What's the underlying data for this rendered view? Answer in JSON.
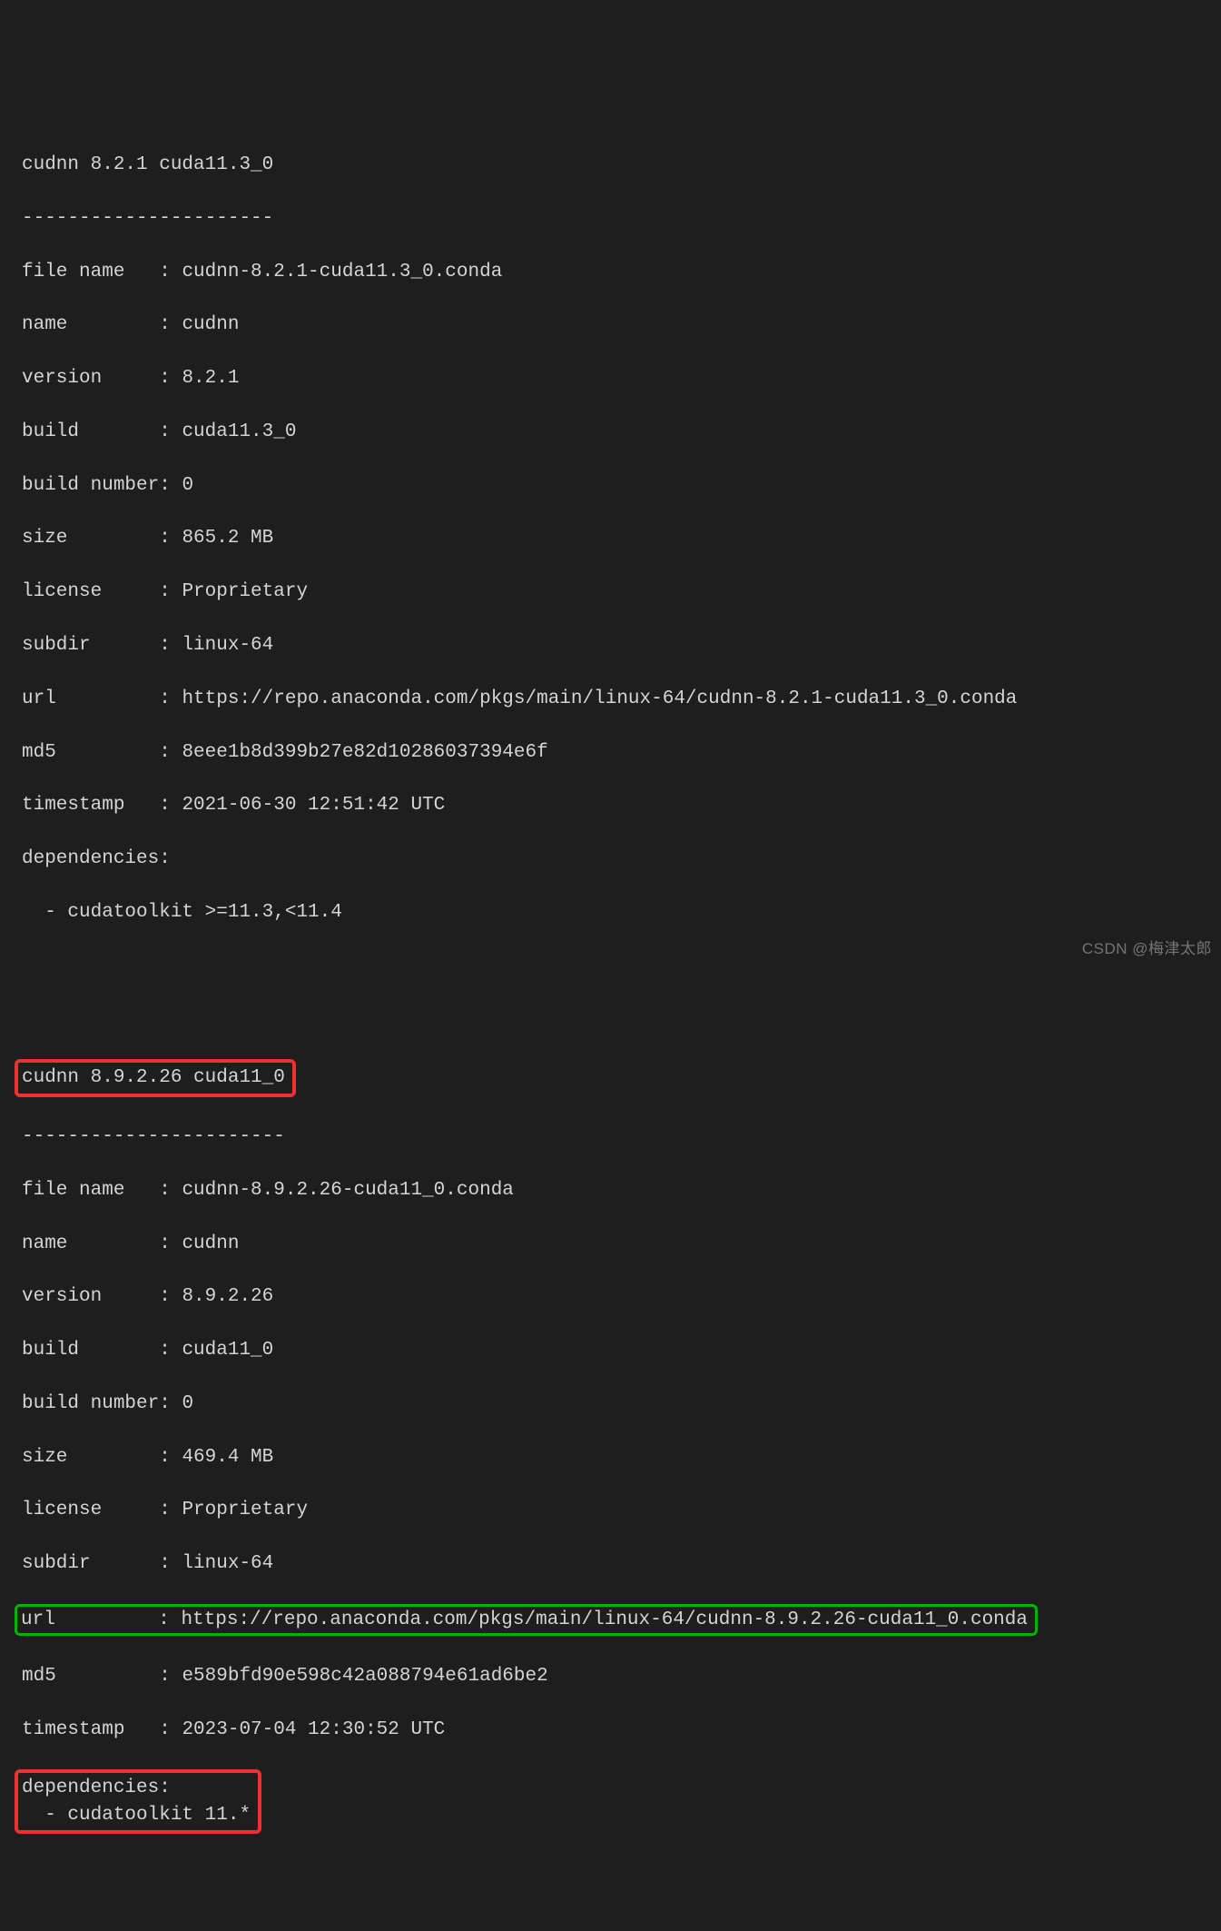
{
  "block1": {
    "header": "cudnn 8.2.1 cuda11.3_0",
    "dashes": "----------------------",
    "file_name_label": "file name   : ",
    "file_name": "cudnn-8.2.1-cuda11.3_0.conda",
    "name_label": "name        : ",
    "name": "cudnn",
    "version_label": "version     : ",
    "version": "8.2.1",
    "build_label": "build       : ",
    "build": "cuda11.3_0",
    "buildnum_label": "build number: ",
    "buildnum": "0",
    "size_label": "size        : ",
    "size": "865.2 MB",
    "license_label": "license     : ",
    "license": "Proprietary",
    "subdir_label": "subdir      : ",
    "subdir": "linux-64",
    "url_label": "url         : ",
    "url": "https://repo.anaconda.com/pkgs/main/linux-64/cudnn-8.2.1-cuda11.3_0.conda",
    "md5_label": "md5         : ",
    "md5": "8eee1b8d399b27e82d10286037394e6f",
    "timestamp_label": "timestamp   : ",
    "timestamp": "2021-06-30 12:51:42 UTC",
    "deps_label": "dependencies: ",
    "deps_item": "  - cudatoolkit >=11.3,<11.4"
  },
  "block2": {
    "header": "cudnn 8.9.2.26 cuda11_0",
    "dashes": "-----------------------",
    "file_name_label": "file name   : ",
    "file_name": "cudnn-8.9.2.26-cuda11_0.conda",
    "name_label": "name        : ",
    "name": "cudnn",
    "version_label": "version     : ",
    "version": "8.9.2.26",
    "build_label": "build       : ",
    "build": "cuda11_0",
    "buildnum_label": "build number: ",
    "buildnum": "0",
    "size_label": "size        : ",
    "size": "469.4 MB",
    "license_label": "license     : ",
    "license": "Proprietary",
    "subdir_label": "subdir      : ",
    "subdir": "linux-64",
    "url_label": "url         : ",
    "url": "https://repo.anaconda.com/pkgs/main/linux-64/cudnn-8.9.2.26-cuda11_0.conda",
    "md5_label": "md5         : ",
    "md5": "e589bfd90e598c42a088794e61ad6be2",
    "timestamp_label": "timestamp   : ",
    "timestamp": "2023-07-04 12:30:52 UTC",
    "deps_label": "dependencies:",
    "deps_item": "  - cudatoolkit 11.*"
  },
  "watermark": "CSDN @梅津太郎"
}
